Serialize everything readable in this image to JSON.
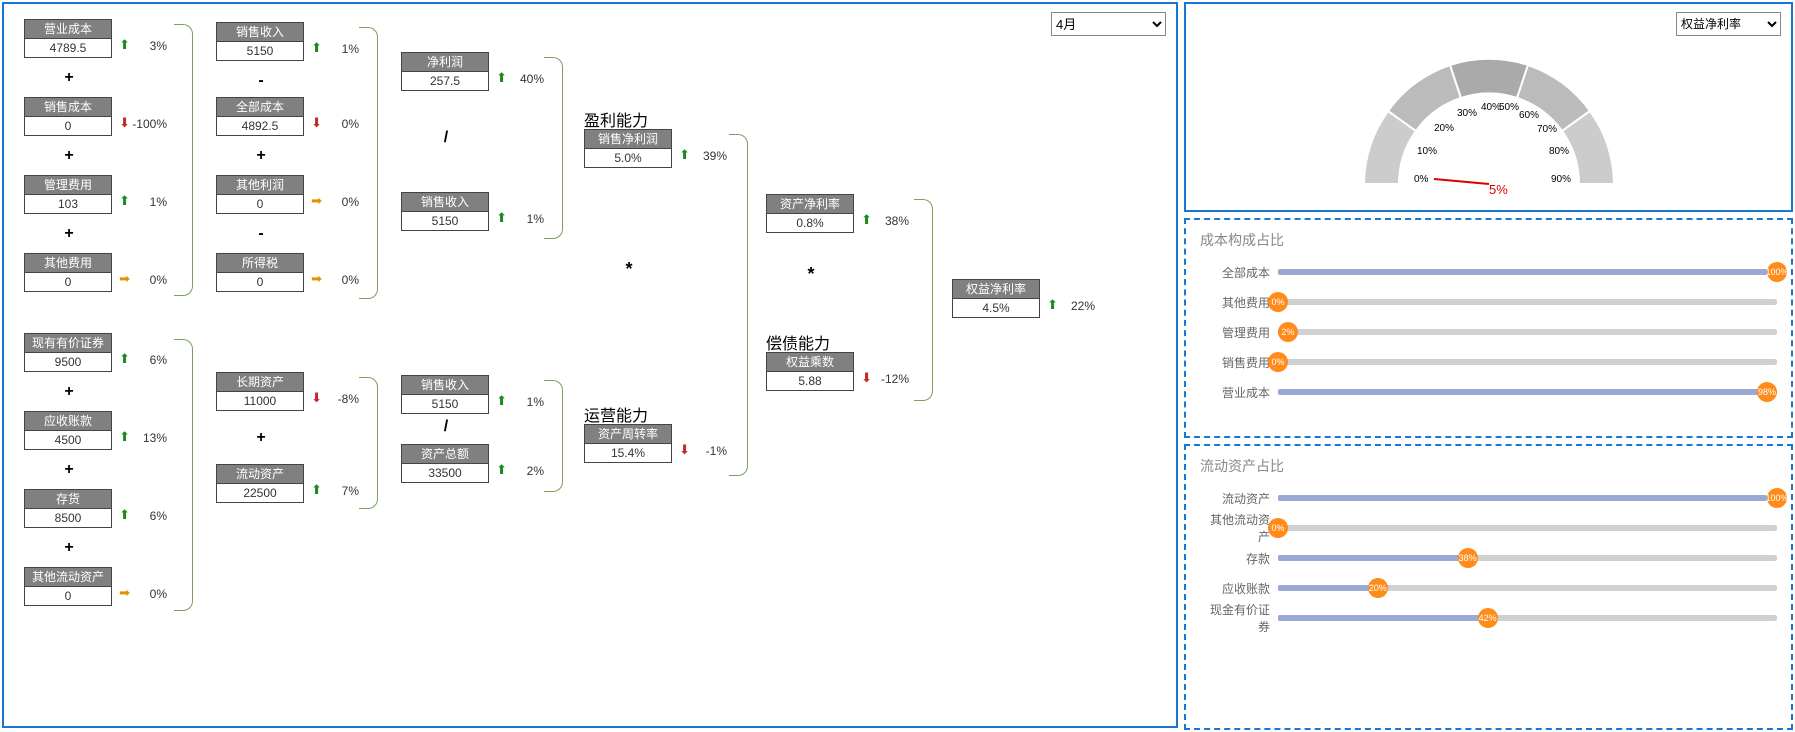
{
  "month_select": {
    "value": "4月"
  },
  "indicator_select": {
    "value": "权益净利率"
  },
  "captions": {
    "profit": "盈利能力",
    "ops": "运营能力",
    "debt": "偿债能力"
  },
  "chart_data": {
    "type": "tree",
    "nodes": {
      "c1a": {
        "label": "营业成本",
        "value": "4789.5",
        "trend": "up",
        "pct": "3%"
      },
      "c1b": {
        "label": "销售成本",
        "value": "0",
        "trend": "down",
        "pct": "-100%"
      },
      "c1c": {
        "label": "管理费用",
        "value": "103",
        "trend": "up",
        "pct": "1%"
      },
      "c1d": {
        "label": "其他费用",
        "value": "0",
        "trend": "flat",
        "pct": "0%"
      },
      "c1e": {
        "label": "现有有价证券",
        "value": "9500",
        "trend": "up",
        "pct": "6%"
      },
      "c1f": {
        "label": "应收账款",
        "value": "4500",
        "trend": "up",
        "pct": "13%"
      },
      "c1g": {
        "label": "存货",
        "value": "8500",
        "trend": "up",
        "pct": "6%"
      },
      "c1h": {
        "label": "其他流动资产",
        "value": "0",
        "trend": "flat",
        "pct": "0%"
      },
      "c2a": {
        "label": "销售收入",
        "value": "5150",
        "trend": "up",
        "pct": "1%"
      },
      "c2b": {
        "label": "全部成本",
        "value": "4892.5",
        "trend": "down",
        "pct": "0%"
      },
      "c2c": {
        "label": "其他利润",
        "value": "0",
        "trend": "flat",
        "pct": "0%"
      },
      "c2d": {
        "label": "所得税",
        "value": "0",
        "trend": "flat",
        "pct": "0%"
      },
      "c2e": {
        "label": "长期资产",
        "value": "11000",
        "trend": "down",
        "pct": "-8%"
      },
      "c2f": {
        "label": "流动资产",
        "value": "22500",
        "trend": "up",
        "pct": "7%"
      },
      "c3a": {
        "label": "净利润",
        "value": "257.5",
        "trend": "up",
        "pct": "40%"
      },
      "c3b": {
        "label": "销售收入",
        "value": "5150",
        "trend": "up",
        "pct": "1%"
      },
      "c3c": {
        "label": "销售收入",
        "value": "5150",
        "trend": "up",
        "pct": "1%"
      },
      "c3d": {
        "label": "资产总额",
        "value": "33500",
        "trend": "up",
        "pct": "2%"
      },
      "c4a": {
        "label": "销售净利润",
        "value": "5.0%",
        "trend": "up",
        "pct": "39%"
      },
      "c4b": {
        "label": "资产周转率",
        "value": "15.4%",
        "trend": "down",
        "pct": "-1%"
      },
      "c5a": {
        "label": "资产净利率",
        "value": "0.8%",
        "trend": "up",
        "pct": "38%"
      },
      "c5b": {
        "label": "权益乘数",
        "value": "5.88",
        "trend": "down",
        "pct": "-12%"
      },
      "c6a": {
        "label": "权益净利率",
        "value": "4.5%",
        "trend": "up",
        "pct": "22%"
      }
    },
    "gauge": {
      "value_label": "5%",
      "ticks": [
        "0%",
        "10%",
        "20%",
        "30%",
        "40%",
        "50%",
        "60%",
        "70%",
        "80%",
        "90%"
      ]
    },
    "cost_bars": {
      "title": "成本构成占比",
      "rows": [
        {
          "label": "全部成本",
          "pct": 100
        },
        {
          "label": "其他费用",
          "pct": 0
        },
        {
          "label": "管理费用",
          "pct": 2
        },
        {
          "label": "销售费用",
          "pct": 0
        },
        {
          "label": "营业成本",
          "pct": 98
        }
      ]
    },
    "asset_bars": {
      "title": "流动资产占比",
      "rows": [
        {
          "label": "流动资产",
          "pct": 100
        },
        {
          "label": "其他流动资产",
          "pct": 0
        },
        {
          "label": "存款",
          "pct": 38
        },
        {
          "label": "应收账款",
          "pct": 20
        },
        {
          "label": "现金有价证券",
          "pct": 42
        }
      ]
    }
  }
}
